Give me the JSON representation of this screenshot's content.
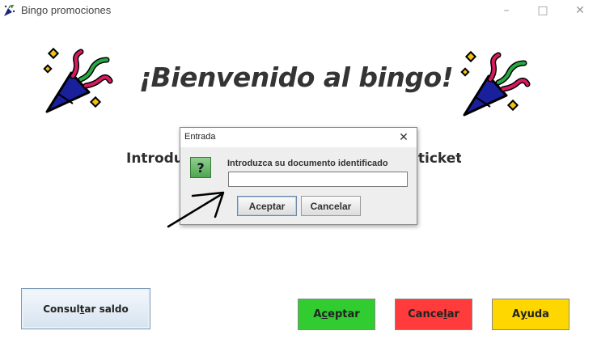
{
  "window": {
    "title": "Bingo promociones",
    "controls": {
      "minimize": "–",
      "maximize": "□",
      "close": "✕"
    }
  },
  "main": {
    "welcome": "¡Bienvenido al bingo!",
    "instruction_left": "Introdu",
    "instruction_right": "ticket",
    "icons": [
      "party-popper-icon",
      "party-popper-icon"
    ]
  },
  "buttons": {
    "consult": {
      "pre": "Consul",
      "mnemonic": "t",
      "post": "ar saldo"
    },
    "accept": {
      "pre": "A",
      "mnemonic": "c",
      "post": "eptar"
    },
    "cancel": {
      "pre": "Cance",
      "mnemonic": "l",
      "post": "ar"
    },
    "help": {
      "pre": "A",
      "mnemonic": "y",
      "post": "uda"
    }
  },
  "dialog": {
    "title": "Entrada",
    "close": "✕",
    "question_mark": "?",
    "prompt": "Introduzca su documento identificado",
    "input_value": "",
    "ok_label": "Aceptar",
    "cancel_label": "Cancelar"
  },
  "colors": {
    "accept": "#30cc30",
    "cancel": "#ff3b3b",
    "help": "#ffd700"
  }
}
